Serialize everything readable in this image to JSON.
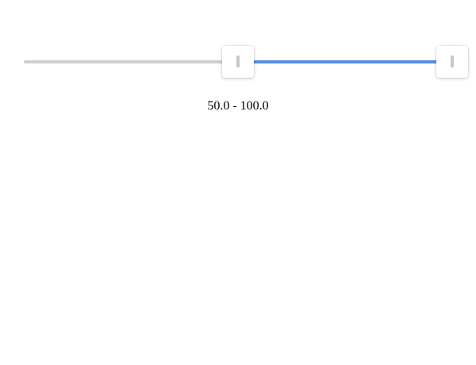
{
  "slider": {
    "min": 0,
    "max": 100,
    "lower_value": 50,
    "upper_value": 100,
    "range_label": "50.0 - 100.0",
    "track_color": "#cfcfcf",
    "fill_color": "#5b8be6",
    "handle_color": "#ffffff",
    "grip_color": "#c8c8c8"
  }
}
